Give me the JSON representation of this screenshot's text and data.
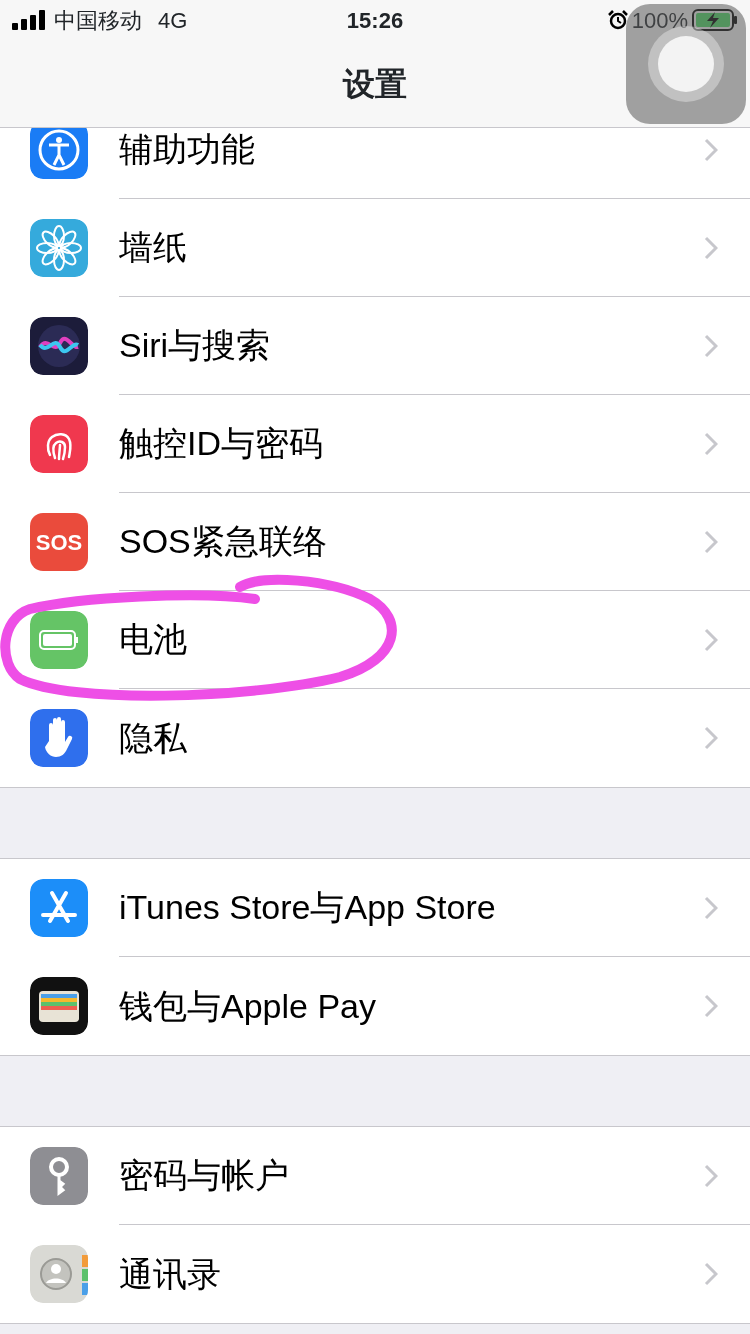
{
  "status_bar": {
    "carrier": "中国移动",
    "network": "4G",
    "time": "15:26",
    "battery_percent": "100%"
  },
  "nav": {
    "title": "设置"
  },
  "groups": [
    {
      "rows": [
        {
          "label": "辅助功能"
        },
        {
          "label": "墙纸"
        },
        {
          "label": "Siri与搜索"
        },
        {
          "label": "触控ID与密码"
        },
        {
          "label": "SOS紧急联络",
          "icon_text": "SOS"
        },
        {
          "label": "电池",
          "highlighted": true
        },
        {
          "label": "隐私"
        }
      ]
    },
    {
      "rows": [
        {
          "label": "iTunes Store与App Store"
        },
        {
          "label": "钱包与Apple Pay"
        }
      ]
    },
    {
      "rows": [
        {
          "label": "密码与帐户"
        },
        {
          "label": "通讯录"
        }
      ]
    }
  ]
}
